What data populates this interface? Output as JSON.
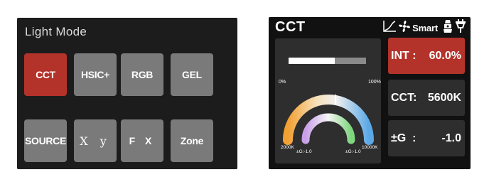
{
  "left_screen": {
    "title": "Light Mode",
    "buttons": [
      {
        "label": "CCT",
        "active": true
      },
      {
        "label": "HSIC+",
        "active": false
      },
      {
        "label": "RGB",
        "active": false
      },
      {
        "label": "GEL",
        "active": false
      },
      {
        "label": "SOURCE",
        "active": false
      },
      {
        "label": "X y",
        "active": false
      },
      {
        "label": "F X",
        "active": false
      },
      {
        "label": "Zone",
        "active": false
      }
    ]
  },
  "right_screen": {
    "title": "CCT",
    "status": {
      "smart_label": "Smart",
      "icons": [
        "curve-icon",
        "fan-icon",
        "lamp-icon",
        "power-plug-icon"
      ]
    },
    "intensity_bar": {
      "min_label": "0%",
      "max_label": "100%",
      "level": 0.6
    },
    "arc": {
      "min_cct_label": "2000K",
      "max_cct_label": "10000K",
      "inner_left_label": "±G:-1.0",
      "inner_right_label": "±G:-1.0"
    },
    "info": [
      {
        "label": "INT :",
        "value": "60.0%",
        "active": true
      },
      {
        "label": "CCT:",
        "value": "5600K",
        "active": false
      },
      {
        "label": "±G  :",
        "value": "-1.0",
        "active": false
      }
    ]
  },
  "colors": {
    "accent_red": "#b3332b",
    "button_grey": "#7a7a7a",
    "panel_grey": "#2e2e2e"
  }
}
